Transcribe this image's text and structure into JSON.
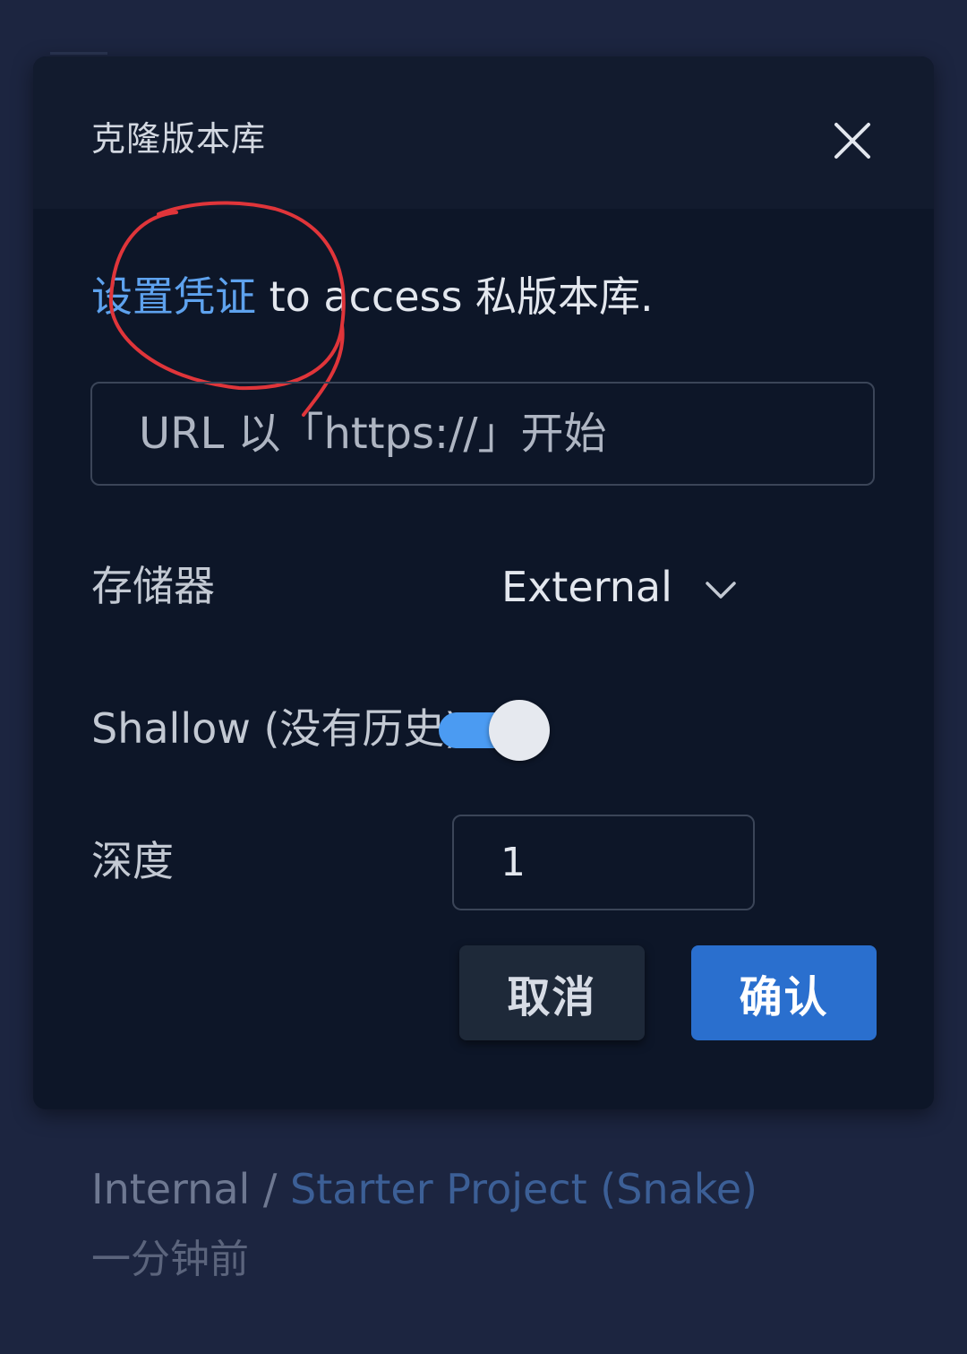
{
  "dialog": {
    "title": "克隆版本库",
    "credentials": {
      "link_text": "设置凭证",
      "rest_text": " to access 私版本库."
    },
    "url_input": {
      "value": "",
      "placeholder": "URL 以「https://」开始"
    },
    "storage": {
      "label": "存储器",
      "value": "External"
    },
    "shallow": {
      "label": "Shallow (没有历史)",
      "enabled": true
    },
    "depth": {
      "label": "深度",
      "value": "1"
    },
    "buttons": {
      "cancel": "取消",
      "confirm": "确认"
    }
  },
  "background": {
    "workspace": "Internal",
    "separator": " / ",
    "project": "Starter Project (Snake)",
    "updated": "一分钟前"
  },
  "colors": {
    "accent": "#2a6fce",
    "link": "#5ea2ee",
    "toggle_on": "#4b9bf2",
    "annotation": "#e0353a"
  },
  "icons": {
    "close": "close-icon",
    "dropdown": "chevron-down-icon"
  }
}
